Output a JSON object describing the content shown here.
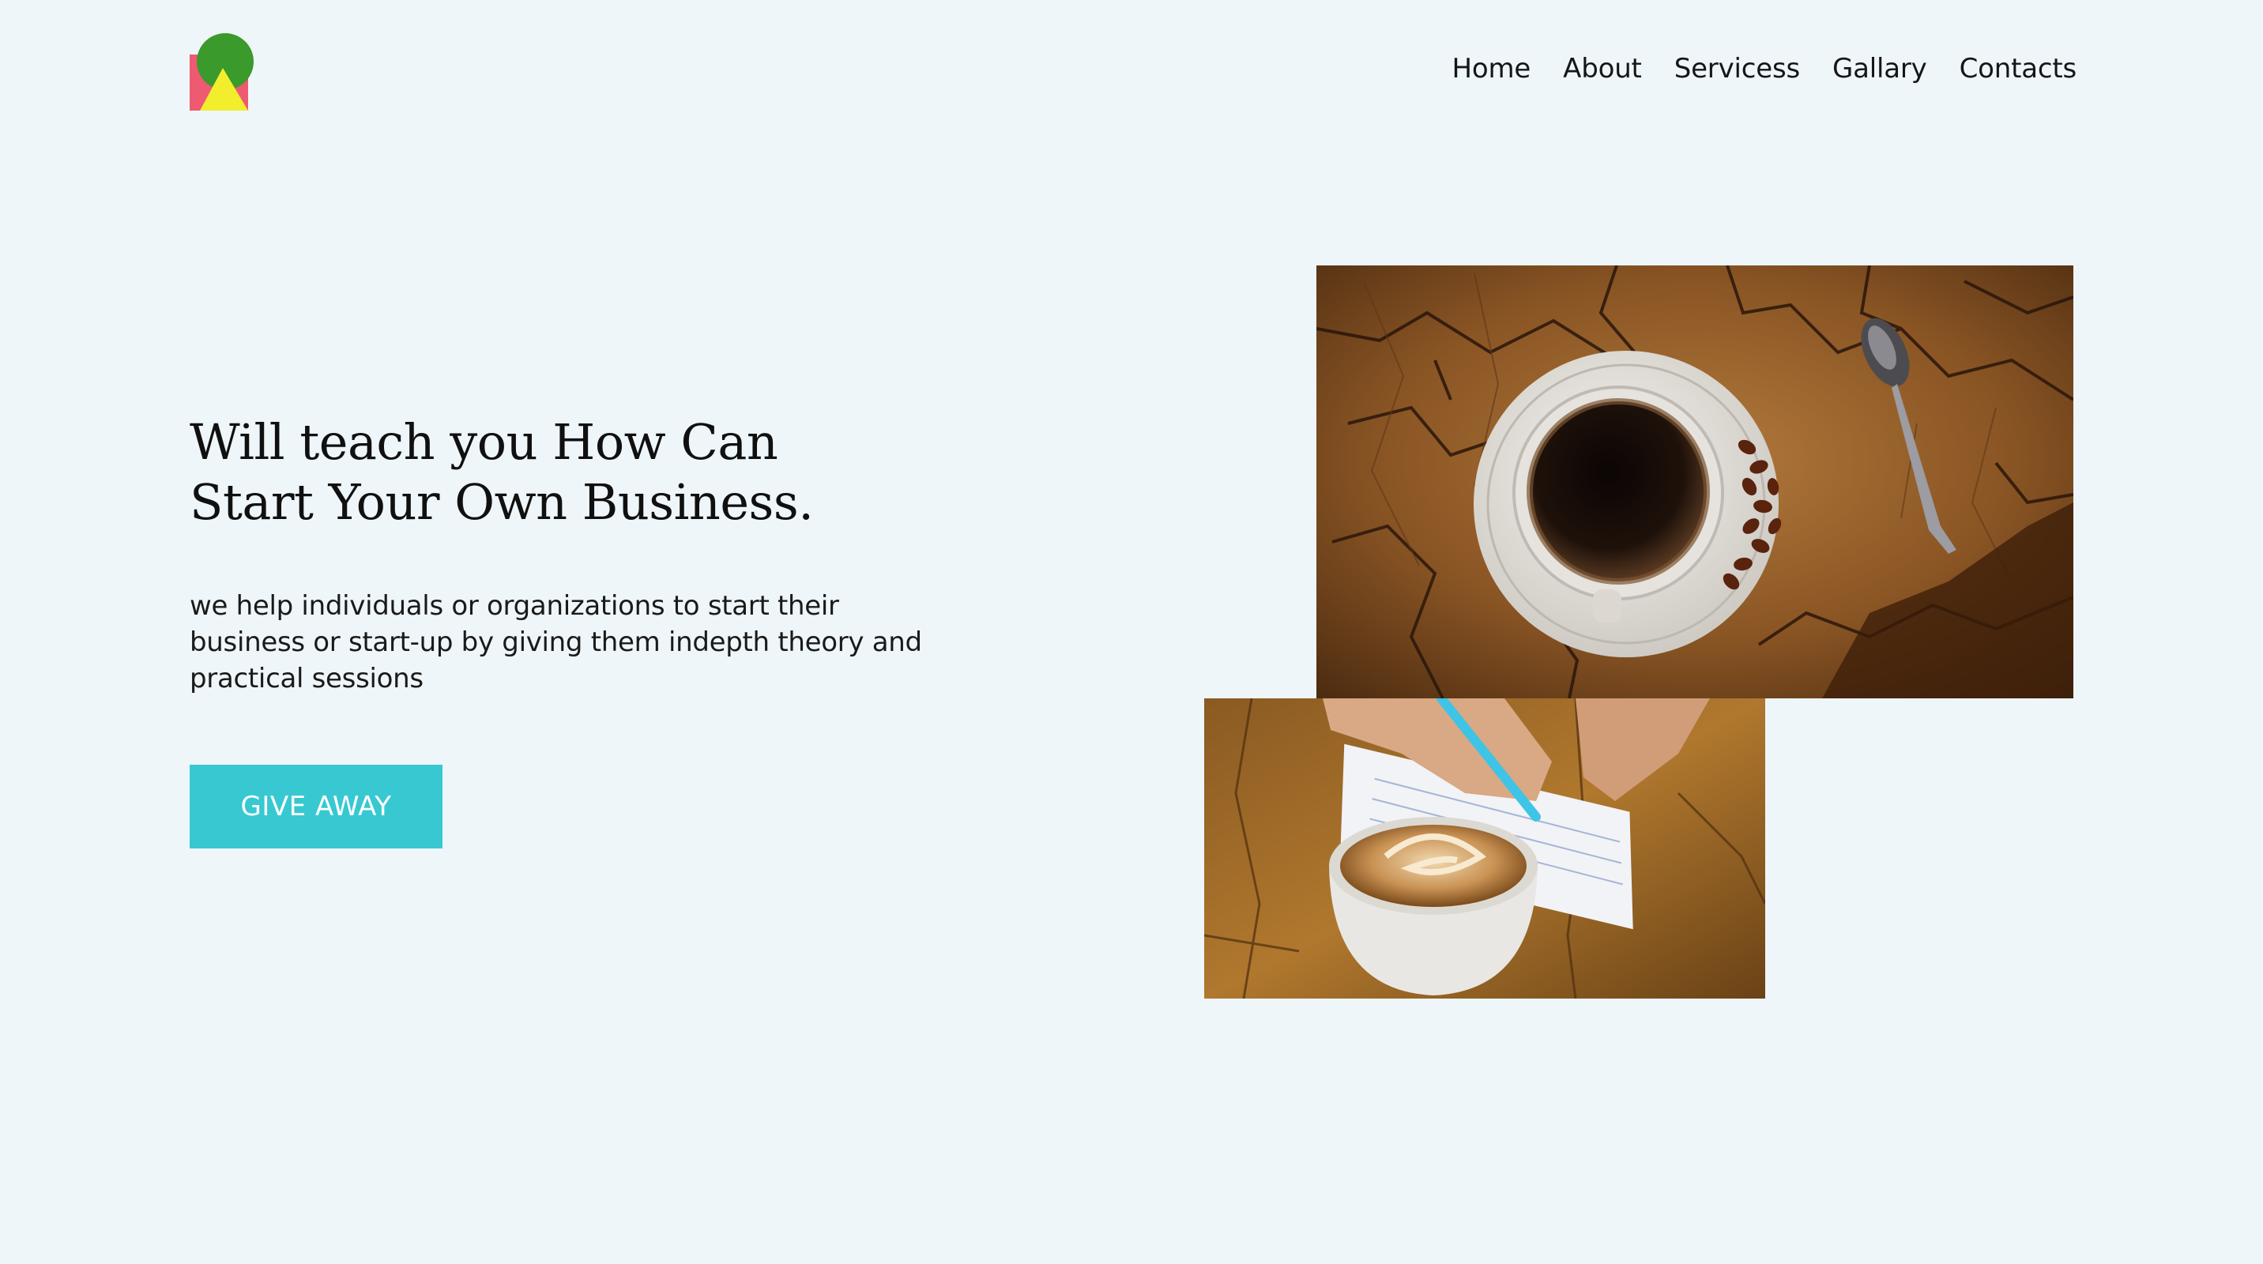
{
  "brand": {
    "logo_icon": "shapes-logo",
    "colors": {
      "circle": "#3A9A2B",
      "square": "#EE5A72",
      "triangle": "#F2EE2E"
    }
  },
  "nav": {
    "items": [
      {
        "label": "Home"
      },
      {
        "label": "About"
      },
      {
        "label": "Servicess"
      },
      {
        "label": "Gallary"
      },
      {
        "label": "Contacts"
      }
    ]
  },
  "hero": {
    "headline_line1": "Will teach you How Can",
    "headline_line2": "Start Your Own Business.",
    "subtext": "we help individuals or organizations to start their business or start-up by giving them indepth theory and practical sessions",
    "cta_label": "GIVE AWAY",
    "cta_color": "#38C8D2"
  },
  "images": {
    "top_photo": "coffee-cup-on-wood-stump",
    "bottom_photo": "latte-and-notebook"
  },
  "theme": {
    "background": "#EEF6F9"
  }
}
